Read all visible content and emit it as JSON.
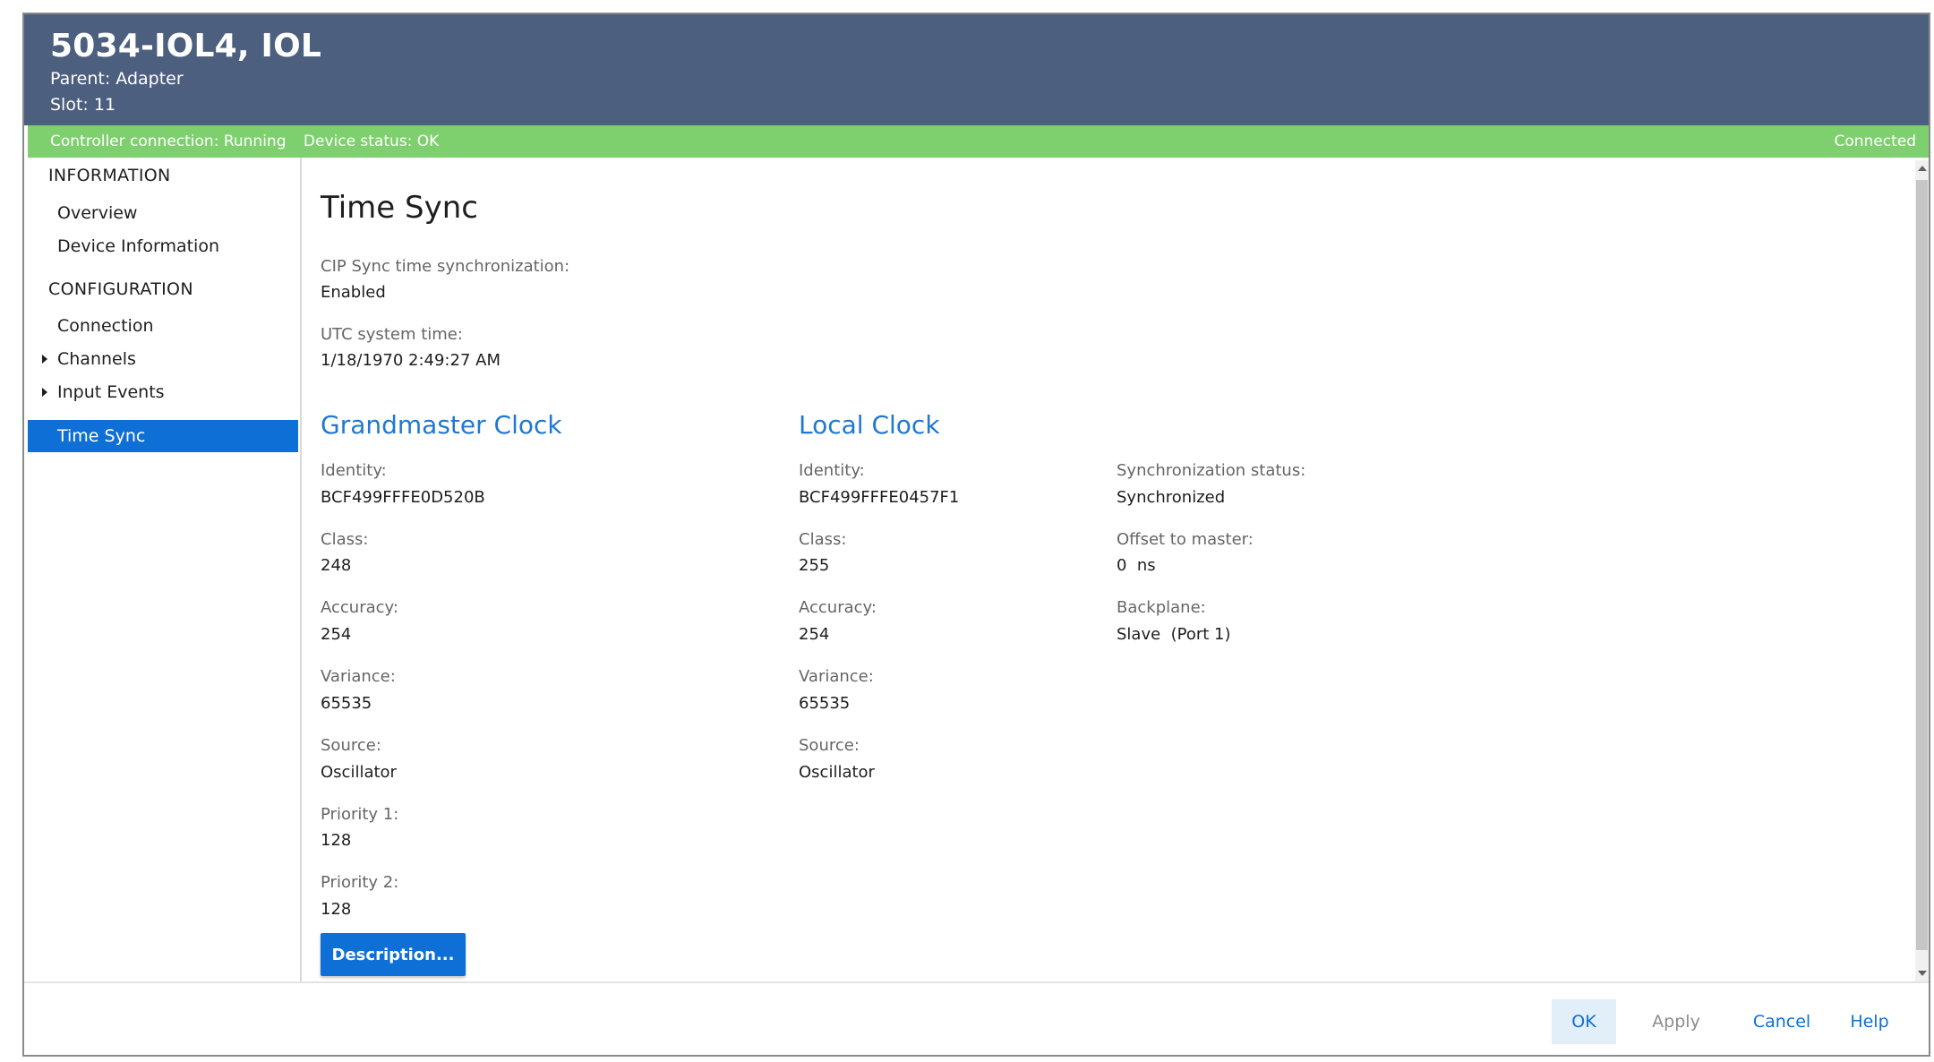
{
  "header": {
    "title": "5034-IOL4, IOL",
    "parent_label": "Parent:",
    "parent_value": "Adapter",
    "slot_label": "Slot:",
    "slot_value": "11",
    "bg_color": "#4d5f7f"
  },
  "statusbar": {
    "controller_connection": "Controller connection: Running",
    "device_status": "Device status: OK",
    "connection_state": "Connected",
    "bg_color": "#7ed06e"
  },
  "sidebar": {
    "information_heading": "INFORMATION",
    "configuration_heading": "CONFIGURATION",
    "items": [
      {
        "label": "Overview",
        "expandable": false,
        "selected": false
      },
      {
        "label": "Device Information",
        "expandable": false,
        "selected": false
      },
      {
        "label": "Connection",
        "expandable": false,
        "selected": false
      },
      {
        "label": "Channels",
        "expandable": true,
        "selected": false
      },
      {
        "label": "Input Events",
        "expandable": true,
        "selected": false
      },
      {
        "label": "Time Sync",
        "expandable": false,
        "selected": true
      }
    ],
    "selected_color": "#0e6fd6"
  },
  "main": {
    "page_title": "Time Sync",
    "cip_sync": {
      "label": "CIP Sync time synchronization:",
      "value": "Enabled"
    },
    "utc_time": {
      "label": "UTC system time:",
      "value": "1/18/1970 2:49:27 AM"
    },
    "grandmaster": {
      "title": "Grandmaster Clock",
      "fields": [
        {
          "label": "Identity:",
          "value": "BCF499FFFE0D520B"
        },
        {
          "label": "Class:",
          "value": "248"
        },
        {
          "label": "Accuracy:",
          "value": "254"
        },
        {
          "label": "Variance:",
          "value": "65535"
        },
        {
          "label": "Source:",
          "value": "Oscillator"
        },
        {
          "label": "Priority 1:",
          "value": "128"
        },
        {
          "label": "Priority 2:",
          "value": "128"
        }
      ]
    },
    "local": {
      "title": "Local Clock",
      "fields": [
        {
          "label": "Identity:",
          "value": "BCF499FFFE0457F1"
        },
        {
          "label": "Class:",
          "value": "255"
        },
        {
          "label": "Accuracy:",
          "value": "254"
        },
        {
          "label": "Variance:",
          "value": "65535"
        },
        {
          "label": "Source:",
          "value": "Oscillator"
        }
      ]
    },
    "status": {
      "fields": [
        {
          "label": "Synchronization status:",
          "value": "Synchronized"
        },
        {
          "label": "Offset to master:",
          "value": "0  ns"
        },
        {
          "label": "Backplane:",
          "value": "Slave  (Port 1)"
        }
      ]
    },
    "description_button": "Description...",
    "accent_color": "#1f78d1"
  },
  "footer": {
    "ok": "OK",
    "apply": "Apply",
    "cancel": "Cancel",
    "help": "Help"
  }
}
